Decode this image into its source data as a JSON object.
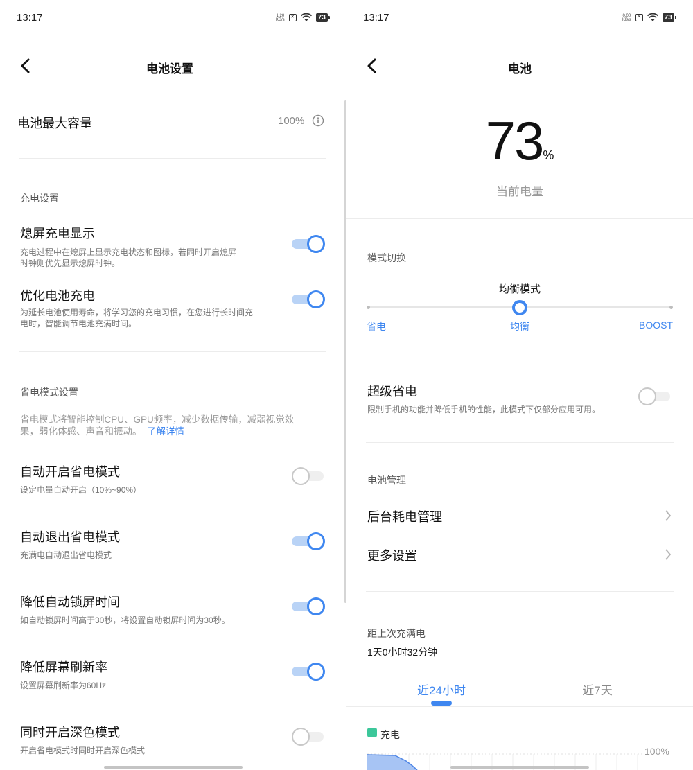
{
  "left": {
    "status": {
      "time": "13:17",
      "speed_value": "1.20",
      "speed_unit": "KB/s",
      "battery": "73"
    },
    "title": "电池设置",
    "max_capacity": {
      "label": "电池最大容量",
      "value": "100%"
    },
    "charging_section": {
      "label": "充电设置",
      "items": [
        {
          "title": "熄屏充电显示",
          "desc1": "充电过程中在熄屏上显示充电状态和图标，若同时开启熄屏",
          "desc2": "时钟则优先显示熄屏时钟。",
          "on": true
        },
        {
          "title": "优化电池充电",
          "desc1": "为延长电池使用寿命，将学习您的充电习惯，在您进行长时间充",
          "desc2": "电时，智能调节电池充满时间。",
          "on": true
        }
      ]
    },
    "power_saving_section": {
      "label": "省电模式设置",
      "desc1": "省电模式将智能控制CPU、GPU频率，减少数据传输，减弱视觉效",
      "desc2": "果，弱化体感、声音和振动。",
      "link": "了解详情",
      "items": [
        {
          "title": "自动开启省电模式",
          "desc": "设定电量自动开启（10%~90%）",
          "on": false
        },
        {
          "title": "自动退出省电模式",
          "desc": "充满电自动退出省电模式",
          "on": true
        },
        {
          "title": "降低自动锁屏时间",
          "desc": "如自动锁屏时间高于30秒，将设置自动锁屏时间为30秒。",
          "on": true
        },
        {
          "title": "降低屏幕刷新率",
          "desc": "设置屏幕刷新率为60Hz",
          "on": true
        },
        {
          "title": "同时开启深色模式",
          "desc": "开启省电模式时同时开启深色模式",
          "on": false
        }
      ]
    }
  },
  "right": {
    "status": {
      "time": "13:17",
      "speed_value": "0.00",
      "speed_unit": "KB/s",
      "battery": "73"
    },
    "title": "电池",
    "battery_level": {
      "value": "73",
      "unit": "%",
      "label": "当前电量"
    },
    "mode": {
      "section_label": "模式切换",
      "current": "均衡模式",
      "options": [
        "省电",
        "均衡",
        "BOOST"
      ],
      "selected_index": 1
    },
    "super_saver": {
      "title": "超级省电",
      "desc": "限制手机的功能并降低手机的性能，此模式下仅部分应用可用。",
      "on": false
    },
    "management": {
      "section_label": "电池管理",
      "items": [
        {
          "label": "后台耗电管理"
        },
        {
          "label": "更多设置"
        }
      ]
    },
    "since_full": {
      "label": "距上次充满电",
      "value": "1天0小时32分钟"
    },
    "tabs": [
      {
        "label": "近24小时",
        "active": true
      },
      {
        "label": "近7天",
        "active": false
      }
    ],
    "chart_legend": {
      "label": "充电",
      "color": "#3cc79a"
    },
    "chart_ylabel": "100%",
    "accent_color": "#3f87f0"
  }
}
